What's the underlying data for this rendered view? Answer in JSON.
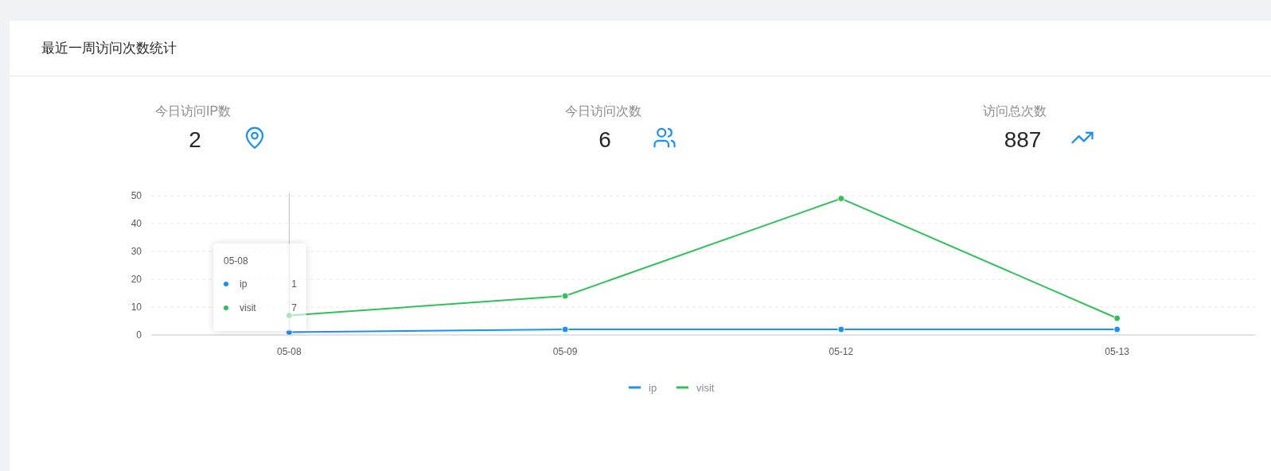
{
  "card": {
    "title": "最近一周访问次数统计"
  },
  "stats": [
    {
      "kind": "pin",
      "label": "今日访问IP数",
      "value": "2"
    },
    {
      "kind": "users",
      "label": "今日访问次数",
      "value": "6"
    },
    {
      "kind": "trend",
      "label": "访问总次数",
      "value": "887"
    }
  ],
  "chart": {
    "chart_data": {
      "type": "line",
      "categories": [
        "05-08",
        "05-09",
        "05-12",
        "05-13"
      ],
      "ylim": [
        0,
        50
      ],
      "yticks": [
        0,
        10,
        20,
        30,
        40,
        50
      ],
      "grid": true,
      "legend": true,
      "ref_lines": [
        {
          "axis": "x",
          "value": "05-08"
        }
      ],
      "series": [
        {
          "name": "ip",
          "color": "#1890ff",
          "marker": "circle",
          "values": [
            1,
            2,
            2,
            2
          ]
        },
        {
          "name": "visit",
          "color": "#2fc25b",
          "marker": "circle",
          "values": [
            7,
            14,
            49,
            6
          ]
        }
      ]
    },
    "tooltip": {
      "title": "05-08",
      "items": [
        {
          "name": "ip",
          "value": "1",
          "color": "#1890ff"
        },
        {
          "name": "visit",
          "value": "7",
          "color": "#2fc25b"
        }
      ]
    }
  }
}
